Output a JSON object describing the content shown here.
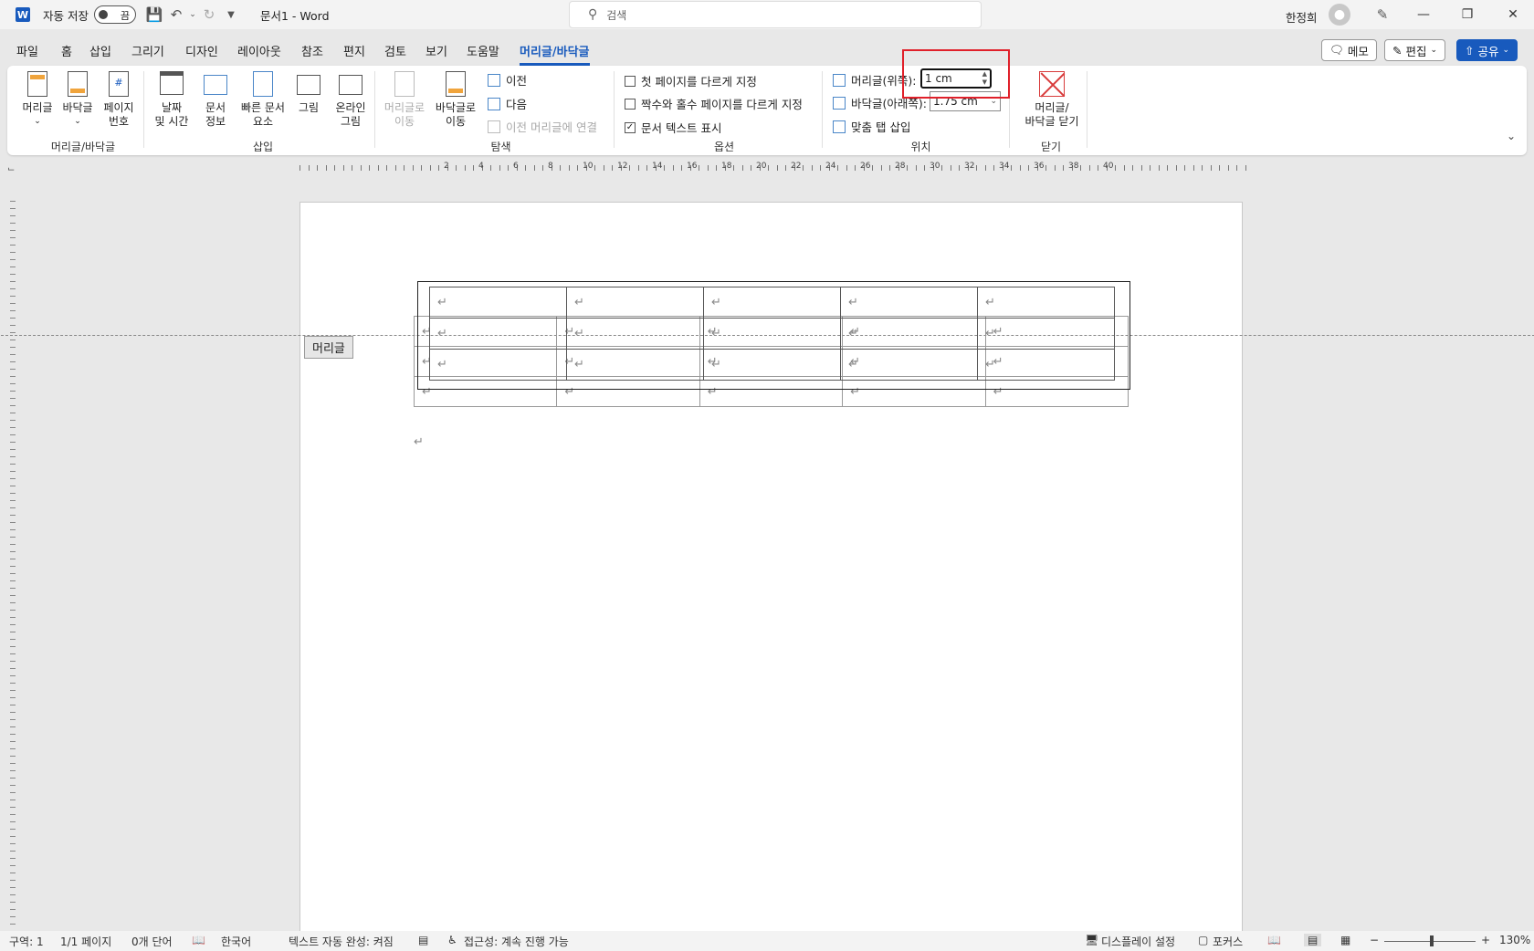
{
  "titlebar": {
    "autosave_label": "자동 저장",
    "autosave_state": "끔",
    "doc_title": "문서1 - Word",
    "search_placeholder": "검색",
    "user_name": "한정희"
  },
  "menu": {
    "tabs": [
      "파일",
      "홈",
      "삽입",
      "그리기",
      "디자인",
      "레이아웃",
      "참조",
      "편지",
      "검토",
      "보기",
      "도움말",
      "머리글/바닥글"
    ],
    "active_tab": "머리글/바닥글",
    "memo": "메모",
    "edit": "편집",
    "share": "공유"
  },
  "ribbon": {
    "group_headerfooter": {
      "label": "머리글/바닥글",
      "header": "머리글",
      "footer": "바닥글",
      "page_number_1": "페이지",
      "page_number_2": "번호"
    },
    "group_insert": {
      "label": "삽입",
      "datetime_1": "날짜",
      "datetime_2": "및 시간",
      "docinfo_1": "문서",
      "docinfo_2": "정보",
      "quickparts_1": "빠른 문서",
      "quickparts_2": "요소",
      "picture": "그림",
      "online_1": "온라인",
      "online_2": "그림"
    },
    "group_nav": {
      "label": "탐색",
      "goto_header_1": "머리글로",
      "goto_header_2": "이동",
      "goto_footer_1": "바닥글로",
      "goto_footer_2": "이동",
      "previous": "이전",
      "next": "다음",
      "link_previous": "이전 머리글에 연결"
    },
    "group_options": {
      "label": "옵션",
      "first_page": "첫 페이지를 다르게 지정",
      "odd_even": "짝수와 홀수 페이지를 다르게 지정",
      "show_doc_text": "문서 텍스트 표시"
    },
    "group_position": {
      "label": "위치",
      "header_top_label": "머리글(위쪽):",
      "header_top_value": "1 cm",
      "footer_bottom_label": "바닥글(아래쪽):",
      "footer_bottom_value": "1.75 cm",
      "insert_align_tab": "맞춤 탭 삽입"
    },
    "group_close": {
      "label": "닫기",
      "close_1": "머리글/",
      "close_2": "바닥글 닫기"
    }
  },
  "ruler": {
    "numbers": [
      "2",
      "4",
      "6",
      "8",
      "10",
      "12",
      "14",
      "16",
      "18",
      "20",
      "22",
      "24",
      "26",
      "28",
      "30",
      "32",
      "34",
      "36",
      "38",
      "40"
    ]
  },
  "document": {
    "header_tag": "머리글",
    "para_mark": "↵"
  },
  "status": {
    "section": "구역: 1",
    "page": "1/1 페이지",
    "words": "0개 단어",
    "language": "한국어",
    "autocomplete": "텍스트 자동 완성: 켜짐",
    "accessibility": "접근성: 계속 진행 가능",
    "display_settings": "디스플레이 설정",
    "focus": "포커스",
    "zoom": "130%",
    "zoom_minus": "−",
    "zoom_plus": "+"
  }
}
